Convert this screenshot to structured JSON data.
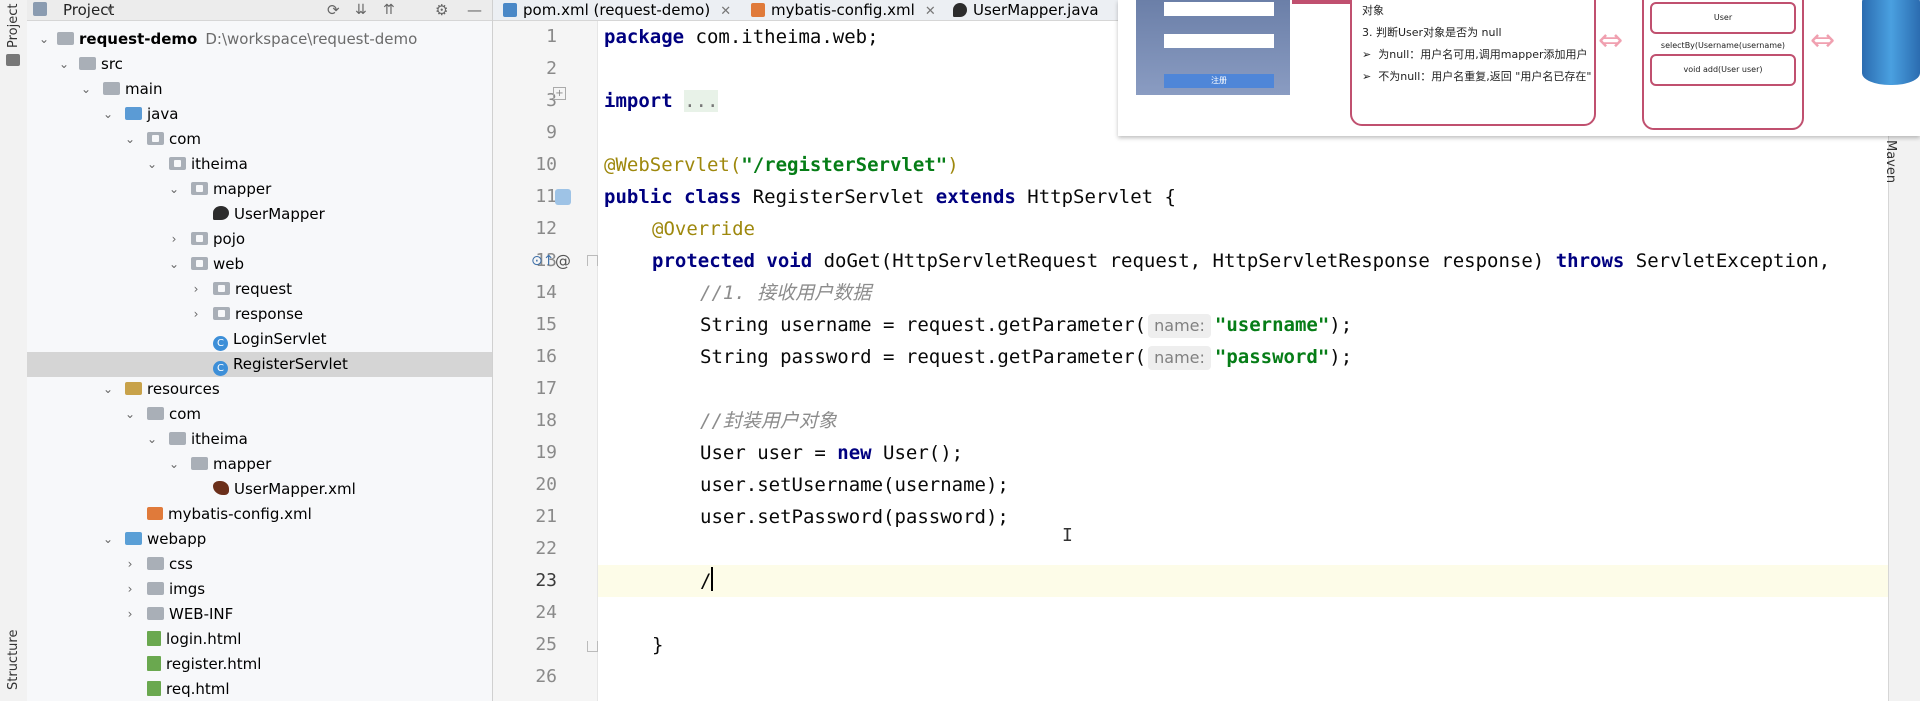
{
  "left_strip": {
    "project_label": "Project",
    "structure_label": "Structure"
  },
  "project_panel": {
    "header_title": "Project",
    "root_name": "request-demo",
    "root_path": "D:\\workspace\\request-demo",
    "items": [
      {
        "label": "src"
      },
      {
        "label": "main"
      },
      {
        "label": "java"
      },
      {
        "label": "com"
      },
      {
        "label": "itheima"
      },
      {
        "label": "mapper"
      },
      {
        "label": "UserMapper"
      },
      {
        "label": "pojo"
      },
      {
        "label": "web"
      },
      {
        "label": "request"
      },
      {
        "label": "response"
      },
      {
        "label": "LoginServlet"
      },
      {
        "label": "RegisterServlet"
      },
      {
        "label": "resources"
      },
      {
        "label": "com"
      },
      {
        "label": "itheima"
      },
      {
        "label": "mapper"
      },
      {
        "label": "UserMapper.xml"
      },
      {
        "label": "mybatis-config.xml"
      },
      {
        "label": "webapp"
      },
      {
        "label": "css"
      },
      {
        "label": "imgs"
      },
      {
        "label": "WEB-INF"
      },
      {
        "label": "login.html"
      },
      {
        "label": "register.html"
      },
      {
        "label": "req.html"
      }
    ]
  },
  "tabs": [
    {
      "label": "pom.xml (request-demo)"
    },
    {
      "label": "mybatis-config.xml"
    },
    {
      "label": "UserMapper.java"
    }
  ],
  "editor": {
    "line_numbers": [
      "1",
      "2",
      "3",
      "9",
      "10",
      "11",
      "12",
      "13",
      "14",
      "15",
      "16",
      "17",
      "18",
      "19",
      "20",
      "21",
      "22",
      "23",
      "24",
      "25",
      "26"
    ],
    "current_line": "23",
    "code": {
      "l1_kw": "package",
      "l1_rest": " com.itheima.web;",
      "l3_kw": "import",
      "l3_fold": "...",
      "l10_ann": "@WebServlet(",
      "l10_str": "\"/registerServlet\"",
      "l10_close": ")",
      "l11_kw1": "public class",
      "l11_mid": " RegisterServlet ",
      "l11_kw2": "extends",
      "l11_rest": " HttpServlet {",
      "l12_ann": "@Override",
      "l13_kw": "protected void",
      "l13_mid": " doGet(HttpServletRequest request, HttpServletResponse response) ",
      "l13_kw2": "throws",
      "l13_rest": " ServletException,",
      "l14_cmt": "//1. 接收用户数据",
      "l15_pre": "String username = request.getParameter(",
      "l15_hint": "name:",
      "l15_str": "\"username\"",
      "l15_post": ");",
      "l16_pre": "String password = request.getParameter(",
      "l16_hint": "name:",
      "l16_str": "\"password\"",
      "l16_post": ");",
      "l18_cmt": "//封装用户对象",
      "l19_pre": "User user = ",
      "l19_kw": "new",
      "l19_post": " User();",
      "l20": "user.setUsername(username);",
      "l21": "user.setPassword(password);",
      "l23": "/",
      "l25": "}"
    }
  },
  "right_strip": {
    "maven_label": "Maven"
  },
  "slide": {
    "title_fragment": "对象",
    "step3": "3. 判断User对象是否为 null",
    "null_case": "为null：用户名可用,调用mapper添加用户",
    "notnull_case": "不为null：用户名重复,返回 \"用户名已存在\"",
    "method_select": "User selectBy(Username(username)",
    "method_add": "void add(User user)",
    "form_button": "注册"
  }
}
